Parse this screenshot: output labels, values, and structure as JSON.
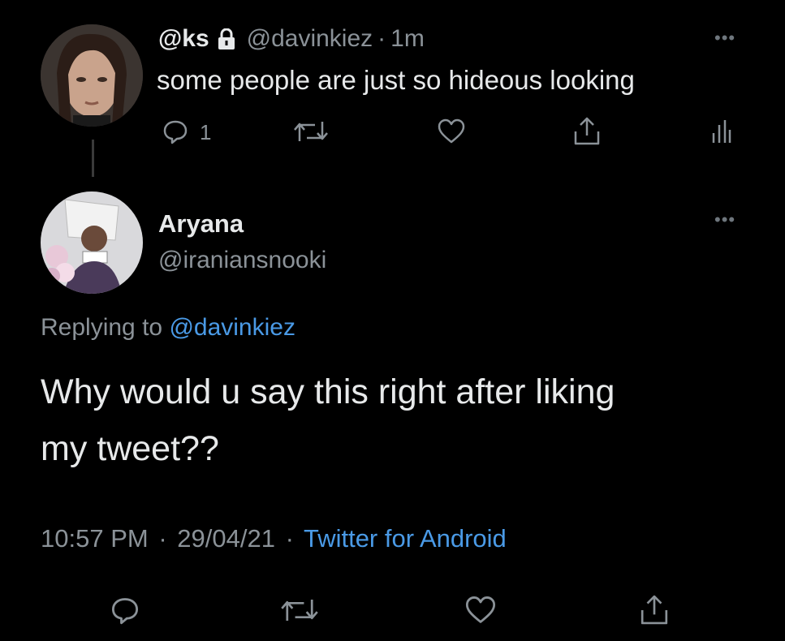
{
  "parent_tweet": {
    "display_name": "@ks",
    "handle": "@davinkiez",
    "separator": "·",
    "time": "1m",
    "text": "some people are just so hideous looking",
    "reply_count": "1",
    "icons": [
      "lock-icon",
      "reply-icon",
      "retweet-icon",
      "like-icon",
      "share-icon",
      "analytics-icon",
      "more-icon"
    ]
  },
  "reply_tweet": {
    "display_name": "Aryana",
    "handle": "@iraniansnooki",
    "replying_prefix": "Replying to",
    "replying_handle": "@davinkiez",
    "text_line1": "Why would u say this right after liking",
    "text_line2": "my tweet??",
    "time": "10:57 PM",
    "date": "29/04/21",
    "dot1": "·",
    "dot2": "·",
    "source": "Twitter for Android",
    "icons": [
      "reply-icon",
      "retweet-icon",
      "like-icon",
      "share-icon",
      "more-icon"
    ]
  },
  "colors": {
    "background": "#000000",
    "text": "#e7e9ea",
    "muted": "#8b9298",
    "link": "#4a9ae6"
  }
}
